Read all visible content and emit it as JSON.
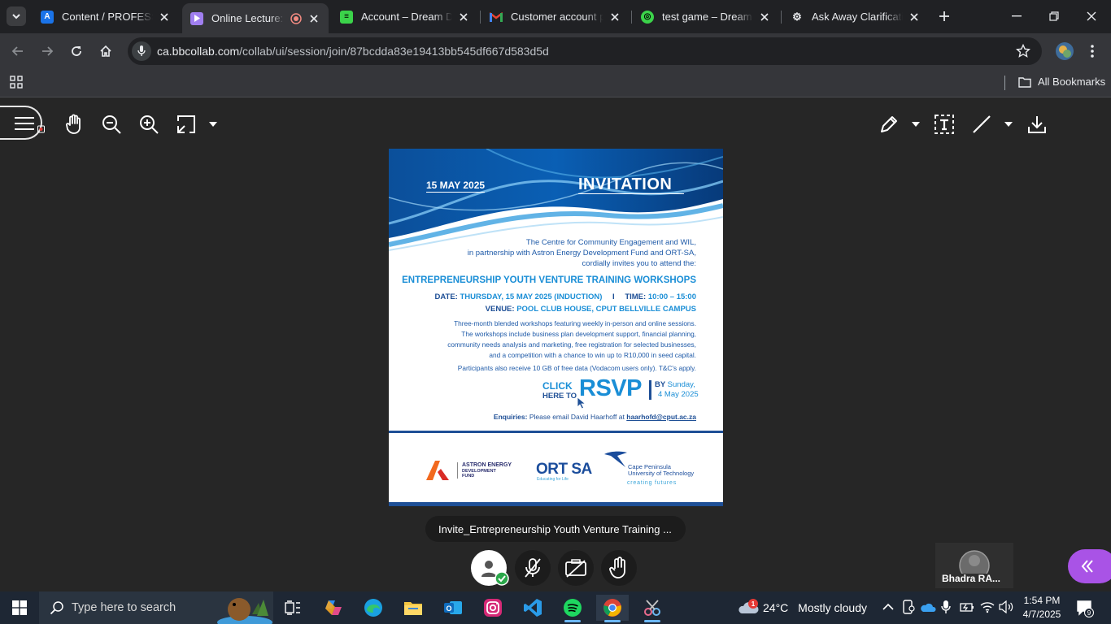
{
  "browser": {
    "tabs": [
      {
        "title": "Content / PROFESSIO",
        "favicon": "a-letter-icon",
        "color": "#1a73e8",
        "letter": "A"
      },
      {
        "title": "Online Lecture: Et",
        "favicon": "play-icon",
        "color": "#a07ff0",
        "letter": "▶"
      },
      {
        "title": "Account – Dream Driv",
        "favicon": "dream-icon",
        "color": "#3bd34a",
        "letter": "≡"
      },
      {
        "title": "Customer account pa",
        "favicon": "gmail-icon",
        "color": "#ea4335",
        "letter": "M"
      },
      {
        "title": "test game – Dream D",
        "favicon": "dream-icon",
        "color": "#3bd34a",
        "letter": "◎"
      },
      {
        "title": "Ask Away Clarificatio",
        "favicon": "openai-icon",
        "color": "#202124",
        "letter": "⚙"
      }
    ],
    "url_host": "ca.bbcollab.com",
    "url_path": "/collab/ui/session/join/87bcdda83e19413bb545df667d583d5d",
    "bookmarks_label": "All Bookmarks"
  },
  "document": {
    "date": "15 MAY 2025",
    "heading": "INVITATION",
    "intro1": "The Centre for Community Engagement and WIL,",
    "intro2": "in partnership with Astron Energy Development Fund and ORT-SA,",
    "intro3": "cordially invites you to attend the:",
    "event_title": "ENTREPRENEURSHIP YOUTH VENTURE TRAINING WORKSHOPS",
    "date_label": "DATE:",
    "date_value": "THURSDAY, 15 MAY 2025 (INDUCTION)",
    "divider": "I",
    "time_label": "TIME:",
    "time_value": "10:00 – 15:00",
    "venue_label": "VENUE:",
    "venue_value": "POOL CLUB HOUSE, CPUT BELLVILLE CAMPUS",
    "body1": "Three-month blended workshops featuring weekly in-person and online sessions.",
    "body2": "The workshops include business plan development support, financial planning,",
    "body3": "community needs analysis and marketing, free registration for selected businesses,",
    "body4": "and a competition with a chance to win up to R10,000 in seed capital.",
    "body5": "Participants also receive 10 GB of free data (Vodacom users only). T&C's apply.",
    "click": "CLICK",
    "here_to": "HERE TO",
    "rsvp": "RSVP",
    "by": "BY",
    "by_day": "Sunday,",
    "by_date": "4 May 2025",
    "enquiries_label": "Enquiries:",
    "enquiries_text": "Please email David Haarhoff at",
    "email": "haarhofd@cput.ac.za",
    "logo1_line1": "ASTRON ENERGY",
    "logo1_line2": "DEVELOPMENT",
    "logo1_line3": "FUND",
    "logo2": "ORT SA",
    "logo2_tag": "Educating for Life",
    "logo3_line1": "Cape Peninsula",
    "logo3_line2": "University of Technology",
    "logo3_tag": "creating futures"
  },
  "session": {
    "file_name": "Invite_Entrepreneurship Youth Venture Training ...",
    "participant_name": "Bhadra RA..."
  },
  "taskbar": {
    "search_placeholder": "Type here to search",
    "weather_temp": "24°C",
    "weather_desc": "Mostly cloudy",
    "weather_badge": "1",
    "time": "1:54 PM",
    "date": "4/7/2025",
    "notif_count": "9"
  }
}
